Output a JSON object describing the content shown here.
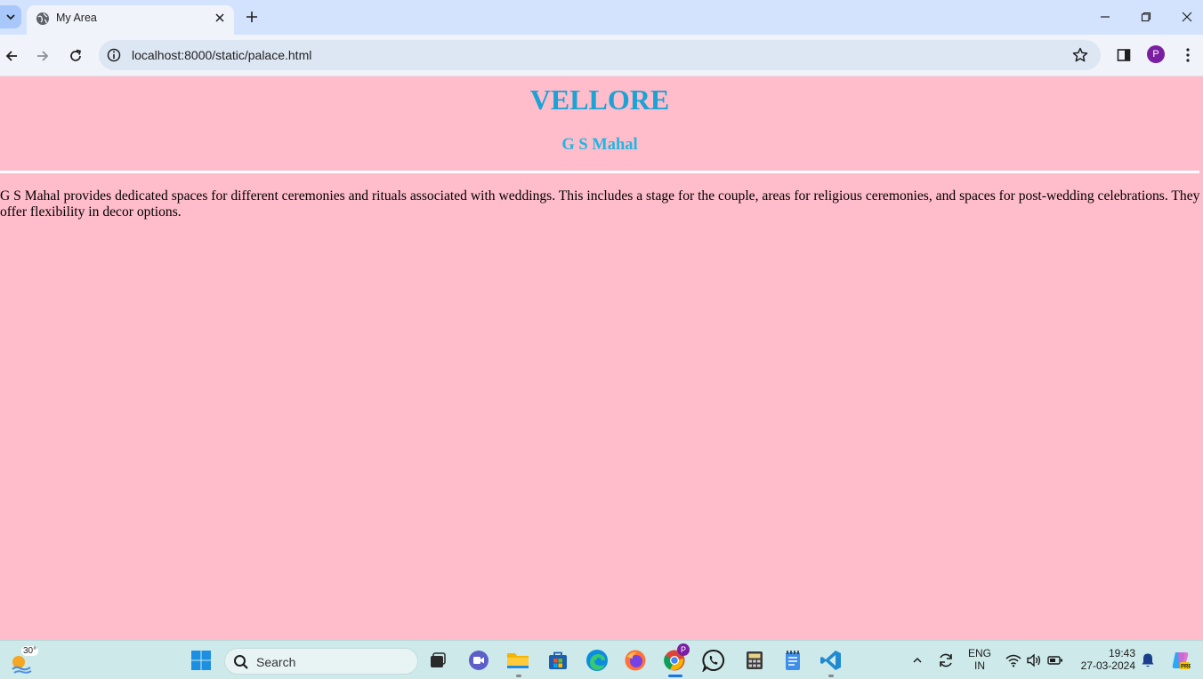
{
  "browser": {
    "tab_title": "My Area",
    "url": "localhost:8000/static/palace.html",
    "profile_initial": "P"
  },
  "page": {
    "heading": "VELLORE",
    "subheading": "G S Mahal",
    "paragraph": "G S Mahal provides dedicated spaces for different ceremonies and rituals associated with weddings. This includes a stage for the couple, areas for religious ceremonies, and spaces for post-wedding celebrations. They offer flexibility in decor options.",
    "background_color": "#ffbccb",
    "heading_color": "#1aa3d4"
  },
  "taskbar": {
    "weather_temp": "30°",
    "search_placeholder": "Search",
    "language": "ENG",
    "region": "IN",
    "time": "19:43",
    "date": "27-03-2024",
    "chrome_badge": "P"
  }
}
